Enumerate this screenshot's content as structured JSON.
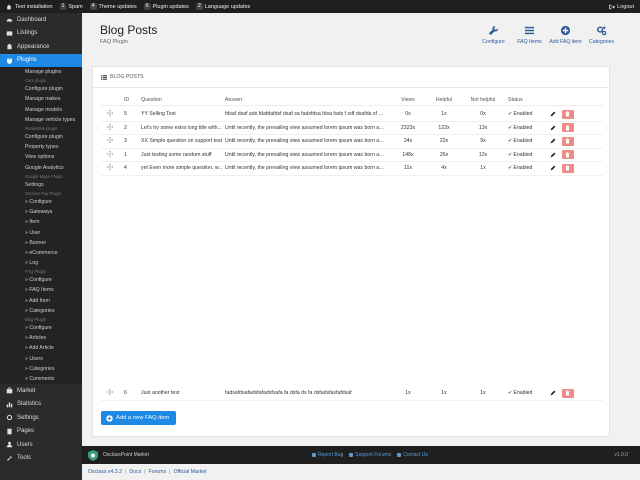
{
  "topbar": {
    "site": "Test installation",
    "items": [
      {
        "count": "1",
        "label": "Spam"
      },
      {
        "count": "4",
        "label": "Theme updates"
      },
      {
        "count": "6",
        "label": "Plugin updates"
      },
      {
        "count": "2",
        "label": "Language updates"
      }
    ],
    "logout": "Logout"
  },
  "sidebar": {
    "top_items": [
      {
        "label": "Dashboard",
        "icon": "dashboard-icon"
      },
      {
        "label": "Listings",
        "icon": "listings-icon"
      },
      {
        "label": "Appearance",
        "icon": "appearance-icon"
      },
      {
        "label": "Plugins",
        "icon": "plugins-icon",
        "active": true
      }
    ],
    "plugin_sub": [
      {
        "label": "Manage plugins"
      },
      {
        "label": "Cars plugin",
        "head": true
      },
      {
        "label": "Configure plugin"
      },
      {
        "label": "Manage makes"
      },
      {
        "label": "Manage models"
      },
      {
        "label": "Manage vehicle types"
      },
      {
        "label": "Realestate plugin",
        "head": true
      },
      {
        "label": "Configure plugin"
      },
      {
        "label": "Property types"
      },
      {
        "label": "View options"
      },
      {
        "label": "Google Analytics"
      },
      {
        "label": "Google Maps Plugin",
        "head": true
      },
      {
        "label": "Settings"
      },
      {
        "label": "Osclass Pay Plugin",
        "head": true
      },
      {
        "label": "» Configure"
      },
      {
        "label": "» Gateways"
      },
      {
        "label": "» Item"
      },
      {
        "label": "» User"
      },
      {
        "label": "» Banner"
      },
      {
        "label": "» eCommerce"
      },
      {
        "label": "» Log"
      },
      {
        "label": "FAQ Plugin",
        "head": true
      },
      {
        "label": "» Configure"
      },
      {
        "label": "» FAQ Items"
      },
      {
        "label": "» Add Item"
      },
      {
        "label": "» Categories"
      },
      {
        "label": "Blog Plugin",
        "head": true
      },
      {
        "label": "» Configure"
      },
      {
        "label": "» Articles"
      },
      {
        "label": "» Add Article"
      },
      {
        "label": "» Users"
      },
      {
        "label": "» Categories"
      },
      {
        "label": "» Comments"
      }
    ],
    "bottom_items": [
      {
        "label": "Market",
        "icon": "market-icon"
      },
      {
        "label": "Statistics",
        "icon": "statistics-icon"
      },
      {
        "label": "Settings",
        "icon": "settings-icon"
      },
      {
        "label": "Pages",
        "icon": "pages-icon"
      },
      {
        "label": "Users",
        "icon": "users-icon"
      },
      {
        "label": "Tools",
        "icon": "tools-icon"
      }
    ]
  },
  "header": {
    "title": "Blog Posts",
    "subtitle": "FAQ Plugin",
    "actions": [
      {
        "label": "Configure",
        "icon": "wrench-icon"
      },
      {
        "label": "FAQ Items",
        "icon": "list-icon"
      },
      {
        "label": "Add FAQ item",
        "icon": "plus-circle-icon"
      },
      {
        "label": "Categories",
        "icon": "cogs-icon"
      }
    ]
  },
  "card": {
    "title": "BLOG POSTS",
    "columns": {
      "id": "ID",
      "question": "Question",
      "answer": "Answer",
      "views": "Views",
      "helpful": "Helpful",
      "not_helpful": "Not helpful",
      "status": "Status"
    },
    "rows": [
      {
        "id": "5",
        "question": "YY Selling Test",
        "answer": "fdsaf dsaf ads fdafdafdsf dsaf sa fadsfdsa   fdsa fads f sdf dsafda sf dsaf",
        "views": "0x",
        "helpful": "1x",
        "not_helpful": "0x",
        "status": "Enabled"
      },
      {
        "id": "2",
        "question": "Let's try some extra long title with...",
        "answer": "Until recently, the prevailing view assumed lorem ipsum was born as a n...",
        "views": "2323x",
        "helpful": "122x",
        "not_helpful": "13x",
        "status": "Enabled"
      },
      {
        "id": "3",
        "question": "XX Simple question on support test",
        "answer": "Until recently, the prevailing view assumed lorem ipsum was born as a n...",
        "views": "24x",
        "helpful": "22x",
        "not_helpful": "9x",
        "status": "Enabled"
      },
      {
        "id": "1",
        "question": "Just testing some random stuff",
        "answer": "Until recently, the prevailing view assumed lorem ipsum was born as a n...",
        "views": "148x",
        "helpful": "26x",
        "not_helpful": "12x",
        "status": "Enabled"
      },
      {
        "id": "4",
        "question": "yet Even more simple question, w...",
        "answer": "Until recently, the prevailing view assumed lorem ipsum was born as a n...",
        "views": "11x",
        "helpful": "4x",
        "not_helpful": "1x",
        "status": "Enabled"
      },
      {
        "id": "6",
        "question": "Just another test",
        "answer": "fadsafdsafadsfafadsfsafa fa dsfa ds fa dsfadsfasfafdsaf",
        "views": "1x",
        "helpful": "1x",
        "not_helpful": "1x",
        "status": "Enabled"
      }
    ],
    "add_button": "Add a new FAQ item"
  },
  "footer": {
    "brand": "OsclassPoint Market",
    "links": [
      "Report Bug",
      "Support Forums",
      "Contact Us"
    ],
    "version": "v1.0.0"
  },
  "breadcrumbs": [
    "Osclass v4.3.2",
    "Docs",
    "Forums",
    "Official Market"
  ],
  "colors": {
    "accent": "#1e88e5",
    "sidebar": "#2b2b2b",
    "danger": "#ef8a8a",
    "success": "#2e7d32"
  }
}
